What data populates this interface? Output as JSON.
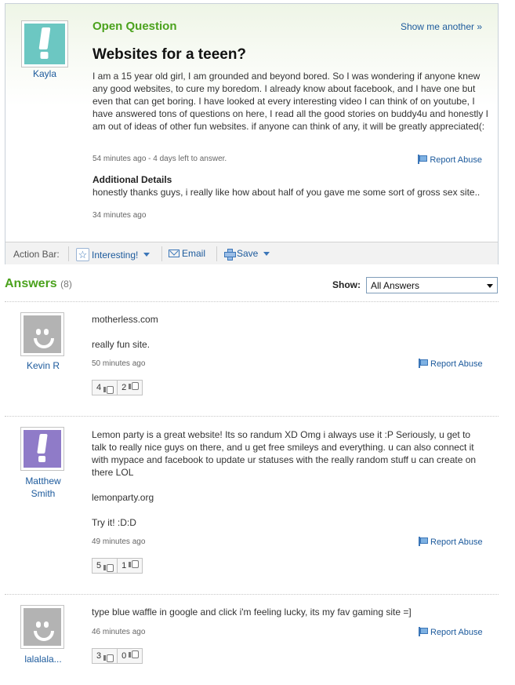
{
  "question": {
    "label": "Open Question",
    "show_another": "Show me another »",
    "title": "Websites for a teeen?",
    "author": "Kayla",
    "body": "I am a 15 year old girl, I am grounded and beyond bored. So I was wondering if anyone knew any good websites, to cure my boredom. I already know about facebook, and I have one but even that can get boring. I have looked at every interesting video I can think of on youtube, I have answered tons of questions on here, I read all the good stories on buddy4u and honestly I am out of ideas of other fun websites. if anyone can think of any, it will be greatly appreciated(:",
    "meta": "54 minutes ago - 4 days left to answer.",
    "report_label": "Report Abuse",
    "additional_title": "Additional Details",
    "additional_body": "honestly thanks guys, i really like how about half of you gave me some sort of gross sex site..",
    "additional_meta": "34 minutes ago"
  },
  "action_bar": {
    "label": "Action Bar:",
    "interesting": "Interesting!",
    "email": "Email",
    "save": "Save"
  },
  "answers_header": {
    "title": "Answers",
    "count": "(8)",
    "show_label": "Show:",
    "show_value": "All Answers"
  },
  "answers": [
    {
      "author": "Kevin R",
      "text": "motherless.com\n\nreally fun site.",
      "meta": "50 minutes ago",
      "report_label": "Report Abuse",
      "up": "4",
      "down": "2"
    },
    {
      "author": "Matthew Smith",
      "text": "Lemon party is a great website! Its so randum XD Omg i always use it :P Seriously, u get to talk to really nice guys on there, and u get free smileys and everything. u can also connect it with mypace and facebook to update ur statuses with the really random stuff u can create on there LOL\n\nlemonparty.org\n\nTry it! :D:D",
      "meta": "49 minutes ago",
      "report_label": "Report Abuse",
      "up": "5",
      "down": "1"
    },
    {
      "author": "lalalala...",
      "text": "type blue waffle in google and click i'm feeling lucky, its my fav gaming site =]",
      "meta": "46 minutes ago",
      "report_label": "Report Abuse",
      "up": "3",
      "down": "0"
    }
  ]
}
